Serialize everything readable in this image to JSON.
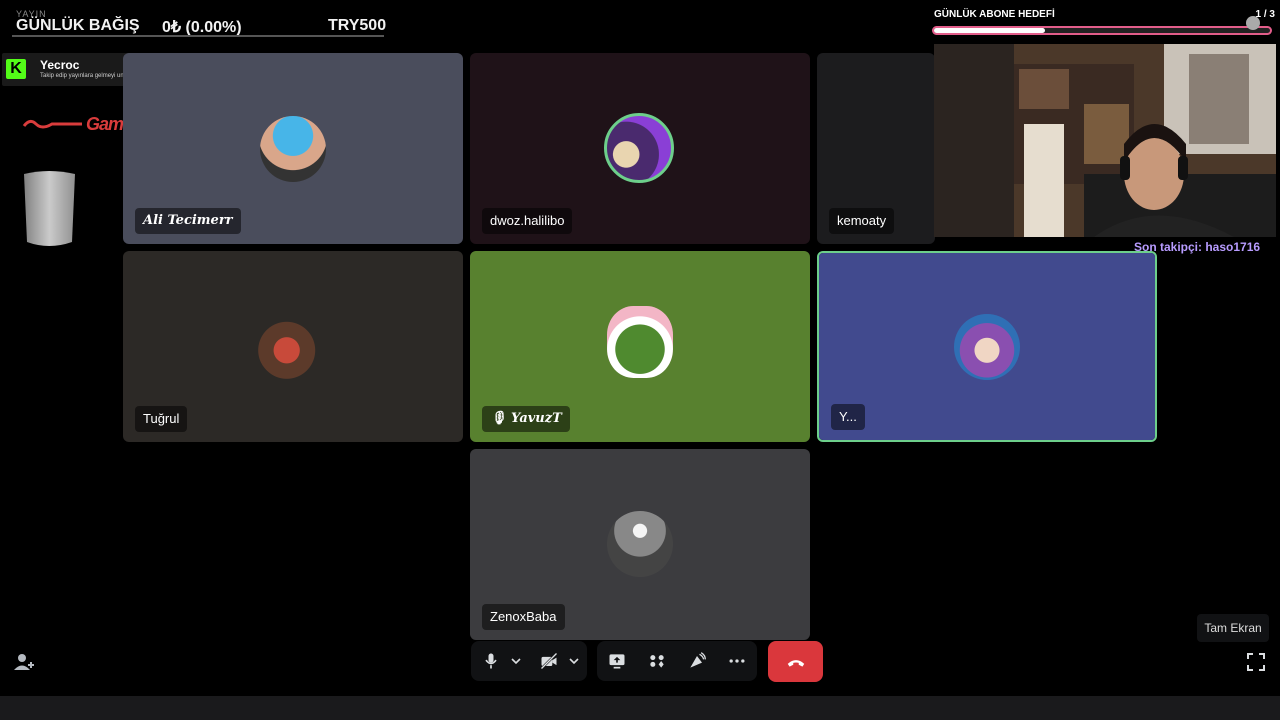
{
  "donation": {
    "faint_text": "YAYIN",
    "title": "GÜNLÜK BAĞIŞ",
    "amount": "0₺ (0.00%)",
    "goal": "TRY500"
  },
  "follower_toast": {
    "logo": "K",
    "name": "Yecroc",
    "message": "Takip edip yayınlara gelmeyi unutma!"
  },
  "brand": {
    "logo_text": "Game"
  },
  "subscriber_goal": {
    "label": "GÜNLÜK ABONE HEDEFİ",
    "count": "1 / 3",
    "progress": 0.33
  },
  "last_follower": "Son takipçi: haso1716",
  "participants": [
    {
      "name": "Ali Tecimerr",
      "color": "#4a4d5c"
    },
    {
      "name": "dwoz.halilibo",
      "color": "#1f1218"
    },
    {
      "name": "kemoaty",
      "color": "#1c1c1e"
    },
    {
      "name": "Tuğrul",
      "color": "#2c2926"
    },
    {
      "name": "YavuzT",
      "color": "#58812f"
    },
    {
      "name": "Y...",
      "color": "#414a8e"
    },
    {
      "name": "ZenoxBaba",
      "color": "#3c3c3f"
    }
  ],
  "tooltip": "Tam Ekran",
  "icons": {
    "mic": "microphone-icon",
    "video_off": "camera-off-icon",
    "screenshare": "screen-share-icon",
    "activities": "activities-icon",
    "soundboard": "soundboard-icon",
    "more": "more-icon",
    "hangup": "hang-up-icon",
    "add_user": "add-user-icon",
    "fullscreen": "fullscreen-icon"
  }
}
